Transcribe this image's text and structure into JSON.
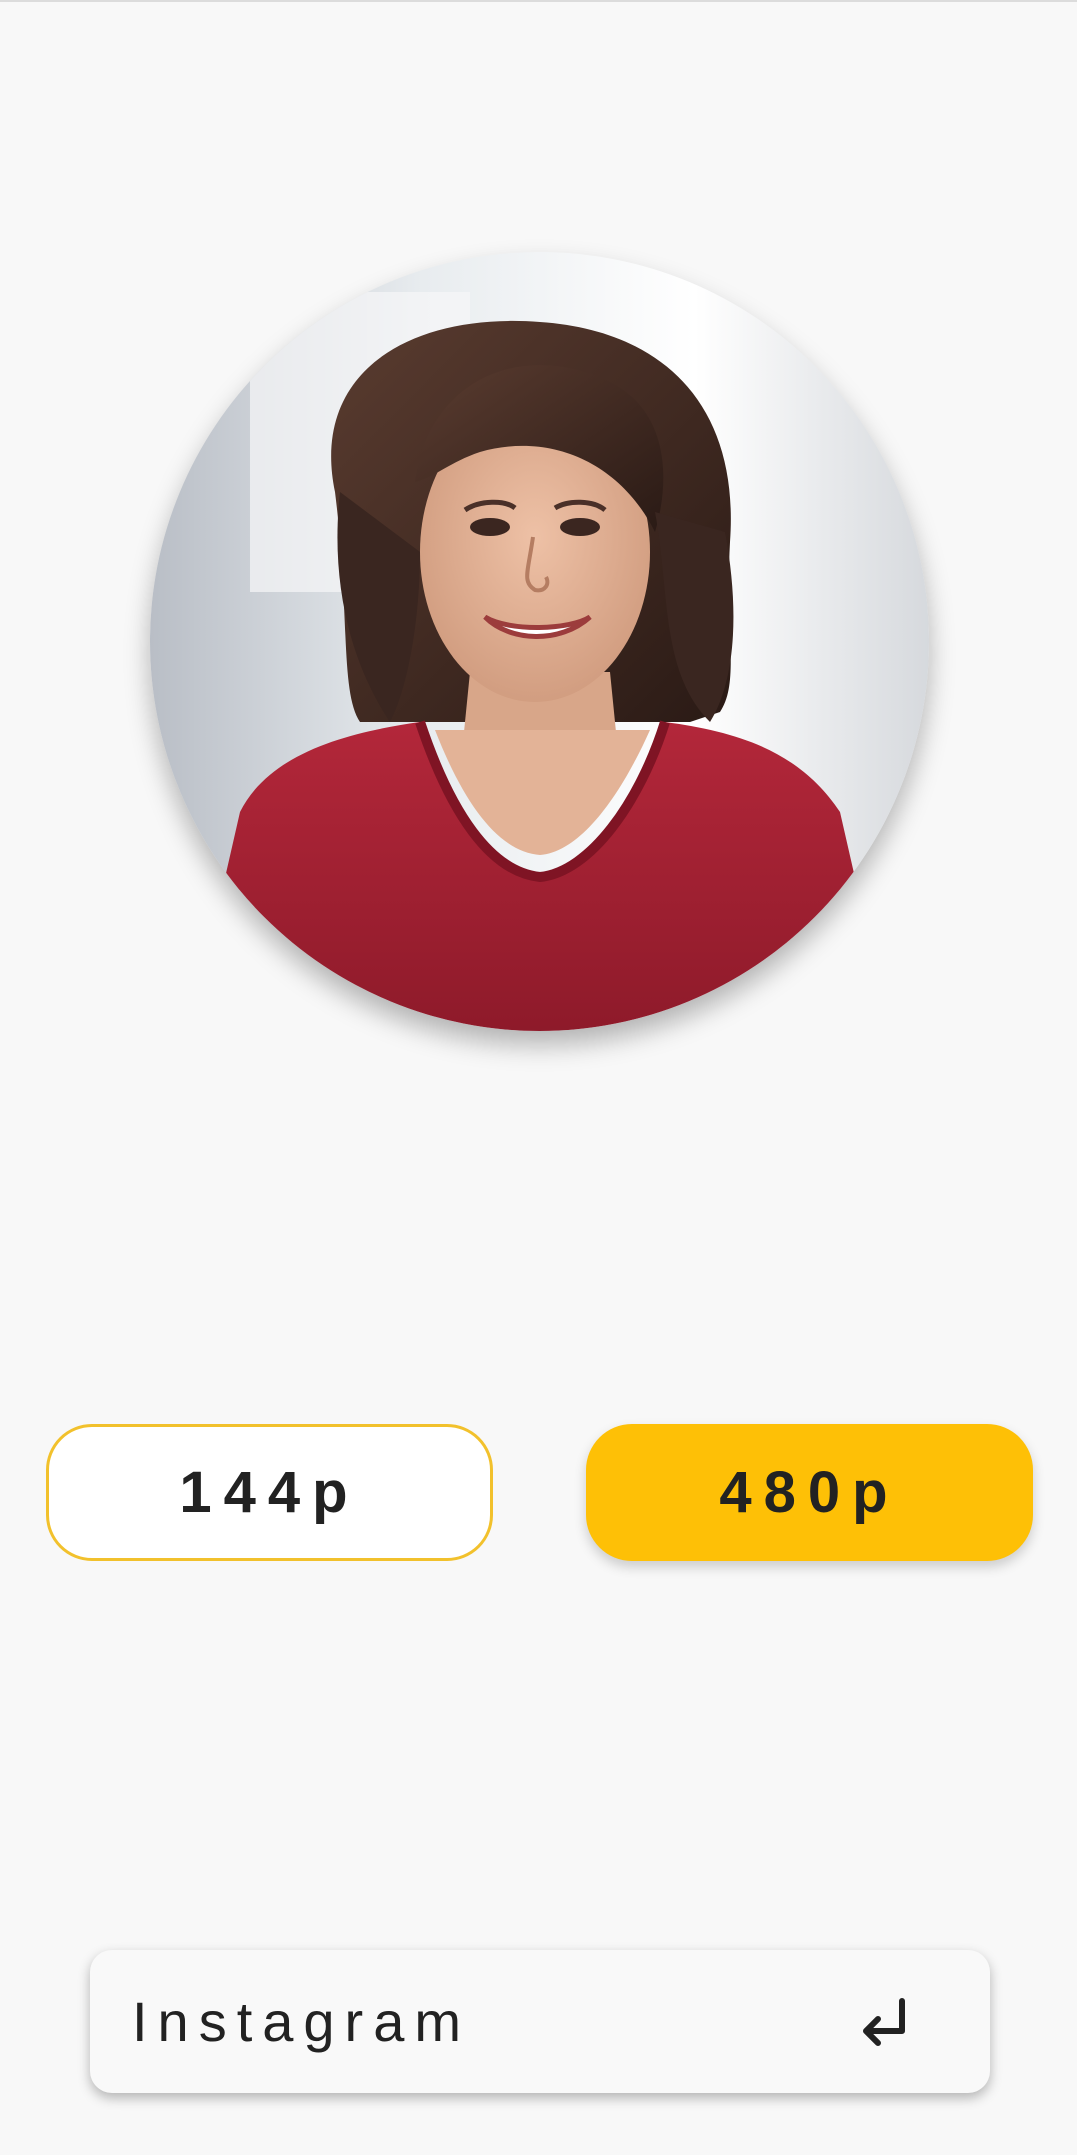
{
  "profile": {
    "image_alt": "profile-photo"
  },
  "quality": {
    "options": [
      "144p",
      "480p"
    ],
    "selected": "480p"
  },
  "input": {
    "value": "Instagram",
    "enter_icon": "enter-return-icon"
  },
  "colors": {
    "accent": "#fec006",
    "outline": "#f2c12c",
    "background": "#f8f8f8"
  }
}
